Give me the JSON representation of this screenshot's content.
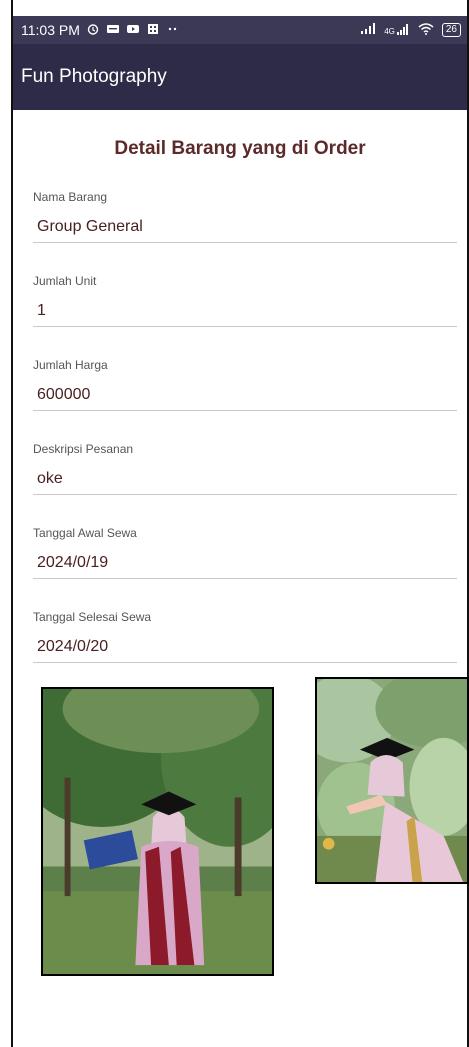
{
  "status_bar": {
    "time": "11:03 PM",
    "network_type": "4G",
    "battery": "26",
    "icons": [
      "alarm-icon",
      "chat-icon",
      "youtube-icon",
      "calendar-icon",
      "more-dots-icon",
      "signal-icon",
      "signal-4g-icon",
      "wifi-icon",
      "battery-icon"
    ]
  },
  "app_bar": {
    "title": "Fun Photography"
  },
  "detail": {
    "title": "Detail Barang yang di Order",
    "fields": [
      {
        "label": "Nama Barang",
        "value": "Group General"
      },
      {
        "label": "Jumlah Unit",
        "value": "1"
      },
      {
        "label": "Jumlah Harga",
        "value": "600000"
      },
      {
        "label": "Deskripsi Pesanan",
        "value": "oke"
      },
      {
        "label": "Tanggal Awal Sewa",
        "value": "2024/0/19"
      },
      {
        "label": "Tanggal Selesai Sewa",
        "value": "2024/0/20"
      }
    ]
  },
  "colors": {
    "status_bar": "#3b3956",
    "app_bar": "#2d2b47",
    "title_text": "#5c2a2a",
    "value_text": "#4a2020"
  }
}
